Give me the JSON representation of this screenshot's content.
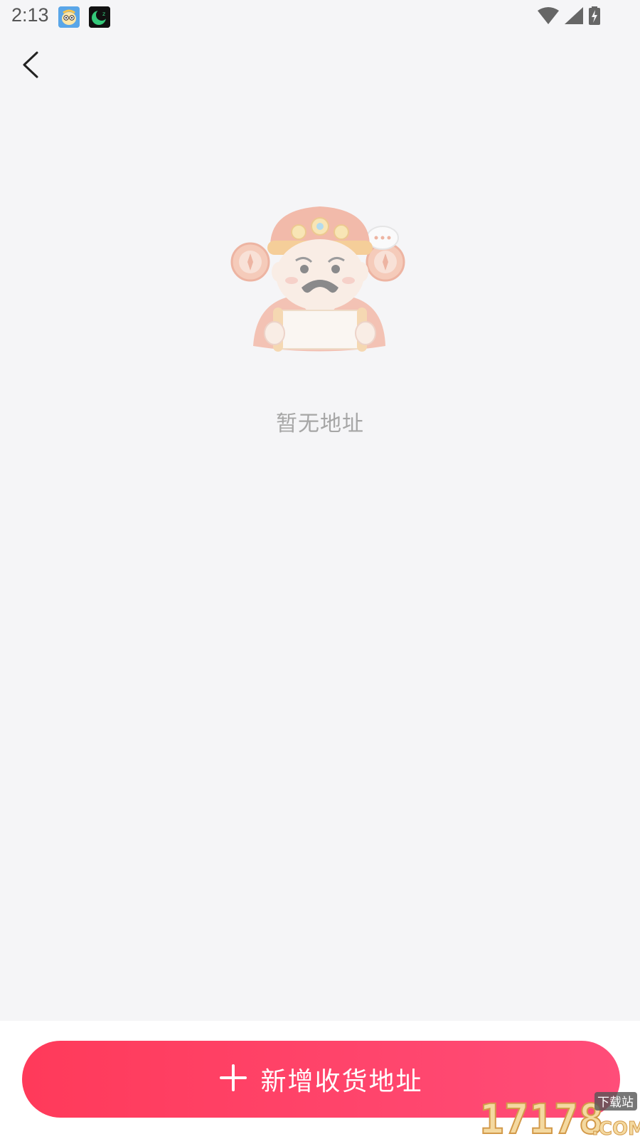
{
  "status_bar": {
    "time": "2:13",
    "notification_icons": [
      "app-mascot-icon",
      "moon-app-icon"
    ],
    "system_icons": [
      "wifi-icon",
      "cellular-signal-icon",
      "battery-charging-icon"
    ]
  },
  "nav": {
    "back_icon": "chevron-left-icon"
  },
  "empty_state": {
    "illustration": "god-of-wealth-scroll-illustration",
    "message": "暂无地址"
  },
  "footer": {
    "add_button_icon": "plus-icon",
    "add_button_label": "新增收货地址"
  },
  "watermark": {
    "text": "17178",
    "suffix": ".COM",
    "tag": "下载站"
  },
  "colors": {
    "accent_start": "#ff3a5a",
    "accent_end": "#ff4d79",
    "background": "#f5f5f7",
    "muted_text": "#a6a6a6"
  }
}
